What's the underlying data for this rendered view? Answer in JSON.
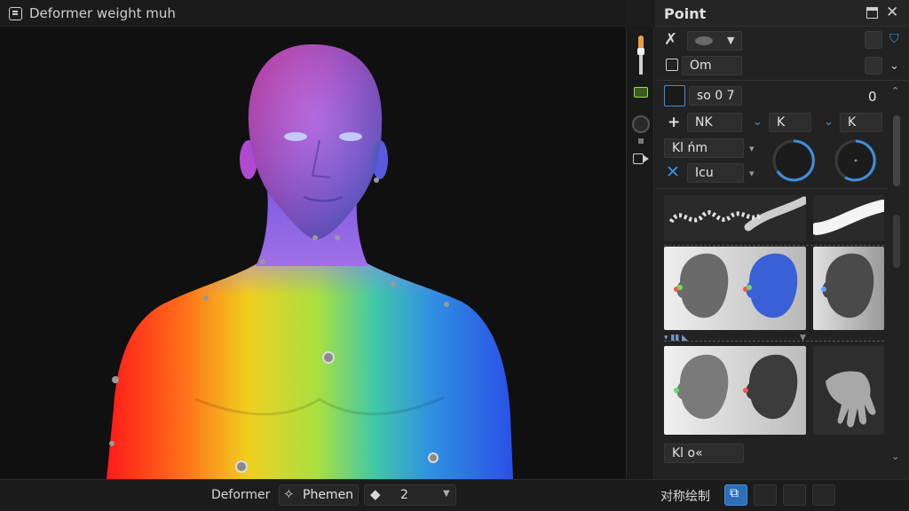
{
  "viewport": {
    "title": "Deformer weight muh"
  },
  "panel": {
    "title": "Point",
    "row1_value": "",
    "row2_label": "Om",
    "row3_value": "so 0 7",
    "row3_right": "0",
    "row4_field": "NK",
    "row4_k1": "K",
    "row4_k2": "K",
    "row5_label": "Kl ńm",
    "row6_label": "Icu",
    "bottom_label": "Kl o«"
  },
  "bottombar": {
    "deformer_label": "Deformer",
    "mode_label": "Phemen",
    "value": "2",
    "cn_label": "对称绘制"
  },
  "colors": {
    "accent": "#3d8fe0",
    "panel_bg": "#222222",
    "viewport_bg": "#101010"
  }
}
